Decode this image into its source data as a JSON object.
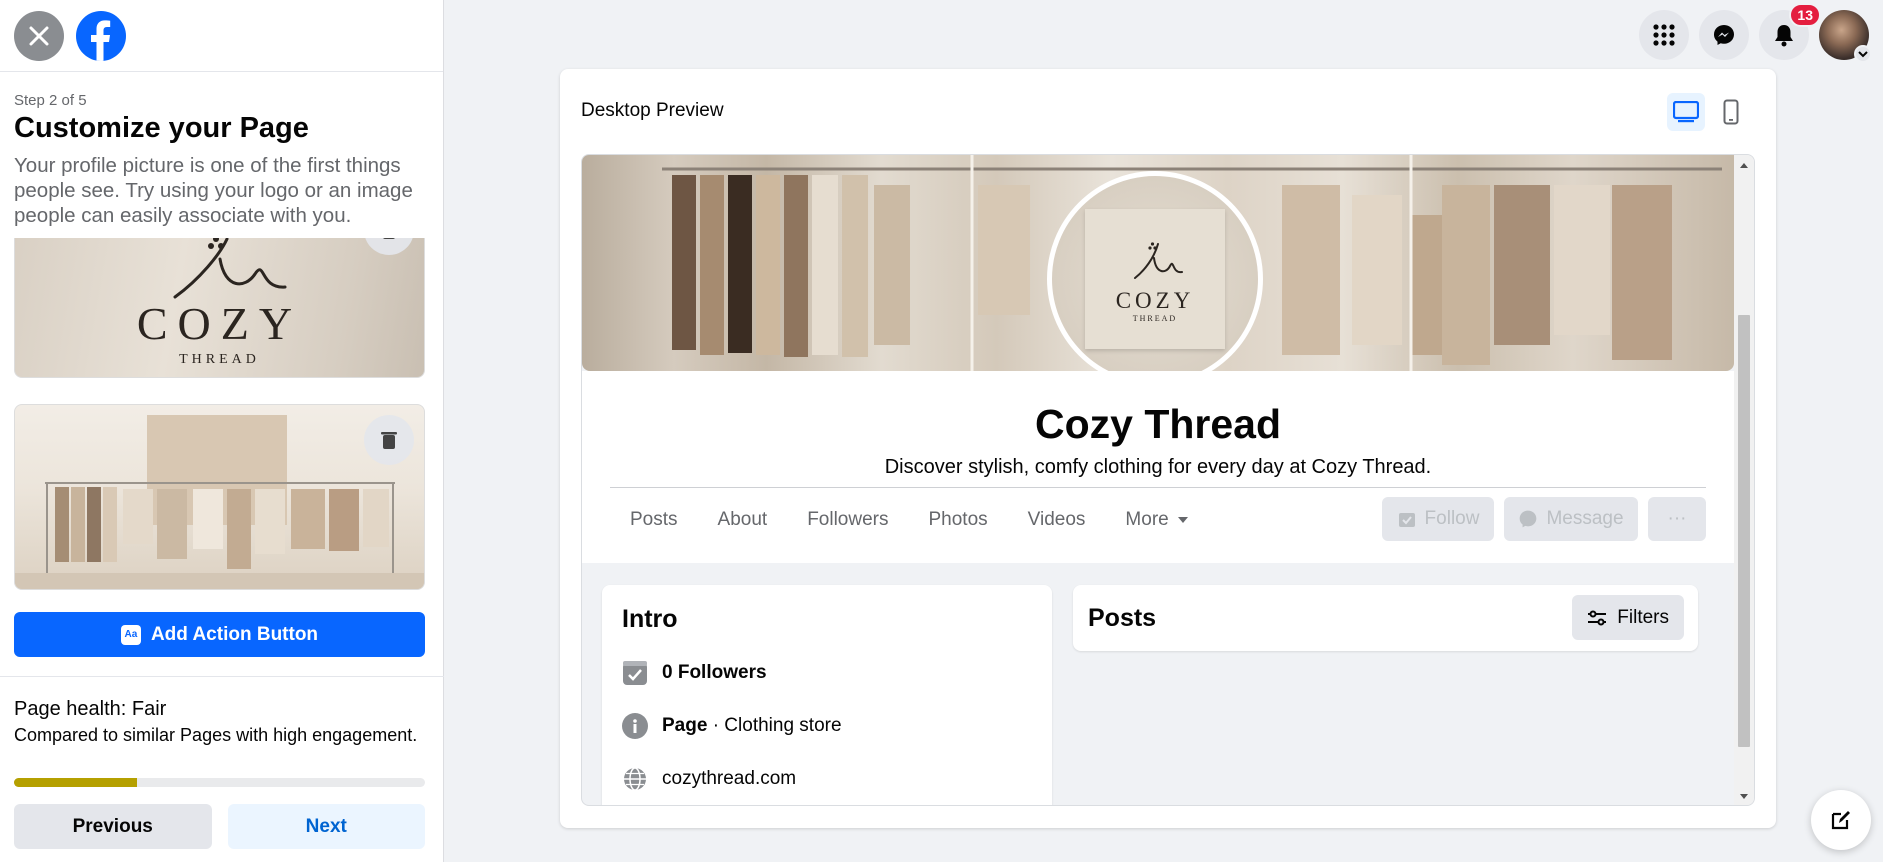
{
  "left": {
    "step": "Step 2 of 5",
    "title": "Customize your Page",
    "description": "Your profile picture is one of the first things people see. Try using your logo or an image people can easily associate with you.",
    "photo_logo_text": "COZY",
    "photo_logo_subtext": "THREAD",
    "action_button": "Add Action Button",
    "health_title": "Page health: Fair",
    "health_desc": "Compared to similar Pages with high engagement.",
    "health_progress": 0.3,
    "previous": "Previous",
    "next": "Next"
  },
  "topbar": {
    "notification_count": "13"
  },
  "preview": {
    "title": "Desktop Preview",
    "page_name": "Cozy Thread",
    "tagline": "Discover stylish, comfy clothing for every day at Cozy Thread.",
    "logo_text": "COZY",
    "logo_subtext": "THREAD",
    "tabs": [
      "Posts",
      "About",
      "Followers",
      "Photos",
      "Videos",
      "More"
    ],
    "follow": "Follow",
    "message": "Message",
    "more_actions": "···",
    "intro": {
      "title": "Intro",
      "followers": "0 Followers",
      "category_label": "Page",
      "category_value": " · Clothing store",
      "website": "cozythread.com"
    },
    "posts_title": "Posts",
    "filters": "Filters"
  },
  "colors": {
    "brand_blue": "#0866ff",
    "health_fill": "#b5a000",
    "badge_red": "#e41e3f"
  }
}
